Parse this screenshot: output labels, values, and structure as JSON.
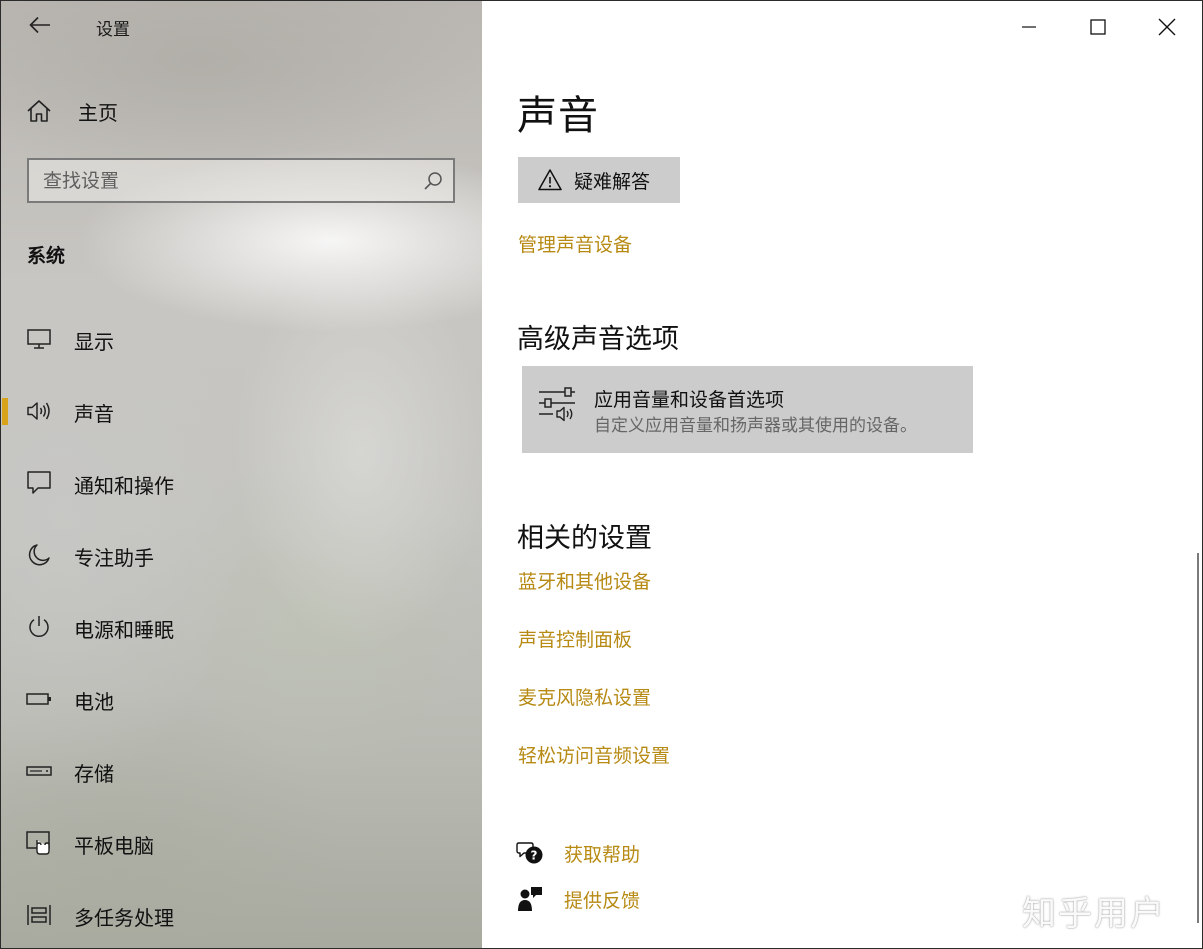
{
  "window": {
    "title": "设置"
  },
  "sidebar": {
    "home_label": "主页",
    "search_placeholder": "查找设置",
    "section_label": "系统",
    "items": [
      {
        "label": "显示",
        "icon": "monitor-icon"
      },
      {
        "label": "声音",
        "icon": "speaker-icon",
        "active": true
      },
      {
        "label": "通知和操作",
        "icon": "message-icon"
      },
      {
        "label": "专注助手",
        "icon": "moon-icon"
      },
      {
        "label": "电源和睡眠",
        "icon": "power-icon"
      },
      {
        "label": "电池",
        "icon": "battery-icon"
      },
      {
        "label": "存储",
        "icon": "storage-drive-icon"
      },
      {
        "label": "平板电脑",
        "icon": "tablet-icon"
      },
      {
        "label": "多任务处理",
        "icon": "multitask-icon"
      }
    ],
    "accent_color": "#d8a21a"
  },
  "main": {
    "page_title": "声音",
    "troubleshoot_label": "疑难解答",
    "manage_devices_link": "管理声音设备",
    "advanced": {
      "heading": "高级声音选项",
      "tile_title": "应用音量和设备首选项",
      "tile_description": "自定义应用音量和扬声器或其使用的设备。"
    },
    "related": {
      "heading": "相关的设置",
      "links": [
        "蓝牙和其他设备",
        "声音控制面板",
        "麦克风隐私设置",
        "轻松访问音频设置"
      ]
    },
    "help": {
      "get_help": "获取帮助",
      "feedback": "提供反馈"
    },
    "link_color": "#b78a14"
  },
  "watermark": "知乎用户"
}
